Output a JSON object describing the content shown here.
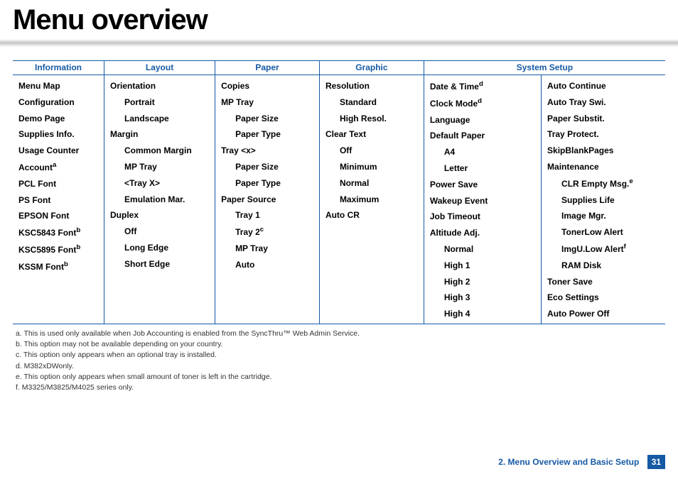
{
  "title": "Menu overview",
  "columns": {
    "information": {
      "header": "Information",
      "items": [
        {
          "label": "Menu Map",
          "level": 0
        },
        {
          "label": "Configuration",
          "level": 0
        },
        {
          "label": "Demo Page",
          "level": 0
        },
        {
          "label": "Supplies Info.",
          "level": 0
        },
        {
          "label": "Usage Counter",
          "level": 0
        },
        {
          "label": "Account",
          "level": 0,
          "sup": "a"
        },
        {
          "label": "PCL Font",
          "level": 0
        },
        {
          "label": "PS Font",
          "level": 0
        },
        {
          "label": "EPSON Font",
          "level": 0
        },
        {
          "label": "KSC5843 Font",
          "level": 0,
          "sup": "b"
        },
        {
          "label": "KSC5895 Font",
          "level": 0,
          "sup": "b"
        },
        {
          "label": "KSSM Font",
          "level": 0,
          "sup": "b"
        }
      ]
    },
    "layout": {
      "header": "Layout",
      "items": [
        {
          "label": "Orientation",
          "level": 0
        },
        {
          "label": "Portrait",
          "level": 1
        },
        {
          "label": "Landscape",
          "level": 1
        },
        {
          "label": "Margin",
          "level": 0
        },
        {
          "label": "Common Margin",
          "level": 1
        },
        {
          "label": "MP Tray",
          "level": 1
        },
        {
          "label": "<Tray X>",
          "level": 1
        },
        {
          "label": "Emulation Mar.",
          "level": 1
        },
        {
          "label": "Duplex",
          "level": 0
        },
        {
          "label": "Off",
          "level": 1
        },
        {
          "label": "Long Edge",
          "level": 1
        },
        {
          "label": "Short Edge",
          "level": 1
        }
      ]
    },
    "paper": {
      "header": "Paper",
      "items": [
        {
          "label": "Copies",
          "level": 0
        },
        {
          "label": "MP Tray",
          "level": 0
        },
        {
          "label": "Paper Size",
          "level": 1
        },
        {
          "label": "Paper Type",
          "level": 1
        },
        {
          "label": "Tray <x>",
          "level": 0
        },
        {
          "label": "Paper Size",
          "level": 1
        },
        {
          "label": "Paper Type",
          "level": 1
        },
        {
          "label": "Paper Source",
          "level": 0
        },
        {
          "label": "Tray 1",
          "level": 1
        },
        {
          "label": "Tray 2",
          "level": 1,
          "sup": "c"
        },
        {
          "label": "MP Tray",
          "level": 1
        },
        {
          "label": "Auto",
          "level": 1
        }
      ]
    },
    "graphic": {
      "header": "Graphic",
      "items": [
        {
          "label": "Resolution",
          "level": 0
        },
        {
          "label": "Standard",
          "level": 1
        },
        {
          "label": "High Resol.",
          "level": 1
        },
        {
          "label": "Clear Text",
          "level": 0
        },
        {
          "label": "Off",
          "level": 1
        },
        {
          "label": "Minimum",
          "level": 1
        },
        {
          "label": "Normal",
          "level": 1
        },
        {
          "label": "Maximum",
          "level": 1
        },
        {
          "label": "Auto CR",
          "level": 0
        }
      ]
    },
    "system1": {
      "items": [
        {
          "label": "Date & Time",
          "level": 0,
          "sup": "d"
        },
        {
          "label": "Clock Mode",
          "level": 0,
          "sup": "d"
        },
        {
          "label": "Language",
          "level": 0
        },
        {
          "label": "Default Paper",
          "level": 0
        },
        {
          "label": "A4",
          "level": 1
        },
        {
          "label": "Letter",
          "level": 1
        },
        {
          "label": "Power Save",
          "level": 0
        },
        {
          "label": "Wakeup Event",
          "level": 0
        },
        {
          "label": "Job Timeout",
          "level": 0
        },
        {
          "label": "Altitude Adj.",
          "level": 0
        },
        {
          "label": "Normal",
          "level": 1
        },
        {
          "label": "High 1",
          "level": 1
        },
        {
          "label": "High 2",
          "level": 1
        },
        {
          "label": "High 3",
          "level": 1
        },
        {
          "label": "High 4",
          "level": 1
        }
      ]
    },
    "system2": {
      "items": [
        {
          "label": "Auto Continue",
          "level": 0
        },
        {
          "label": "Auto Tray Swi.",
          "level": 0
        },
        {
          "label": "Paper Substit.",
          "level": 0
        },
        {
          "label": "Tray Protect.",
          "level": 0
        },
        {
          "label": "SkipBlankPages",
          "level": 0
        },
        {
          "label": "Maintenance",
          "level": 0
        },
        {
          "label": "CLR Empty Msg.",
          "level": 1,
          "sup": "e"
        },
        {
          "label": "Supplies Life",
          "level": 1
        },
        {
          "label": "Image Mgr.",
          "level": 1
        },
        {
          "label": "TonerLow Alert",
          "level": 1
        },
        {
          "label": "ImgU.Low Alert",
          "level": 1,
          "sup": "f"
        },
        {
          "label": "RAM Disk",
          "level": 1
        },
        {
          "label": "Toner Save",
          "level": 0
        },
        {
          "label": "Eco Settings",
          "level": 0
        },
        {
          "label": "Auto Power Off",
          "level": 0
        }
      ]
    },
    "systemHeader": "System Setup"
  },
  "footnotes": [
    "a.  This is used only available when Job Accounting is enabled from the SyncThru™ Web Admin Service.",
    "b.  This option may not be available depending on your country.",
    "c.  This option only appears when an optional tray is installed.",
    "d.  M382xDWonly.",
    "e.  This option only appears when small amount of toner is left in the cartridge.",
    "f.   M3325/M3825/M4025 series only."
  ],
  "footer": {
    "chapter": "2. Menu Overview and Basic Setup",
    "page": "31"
  }
}
